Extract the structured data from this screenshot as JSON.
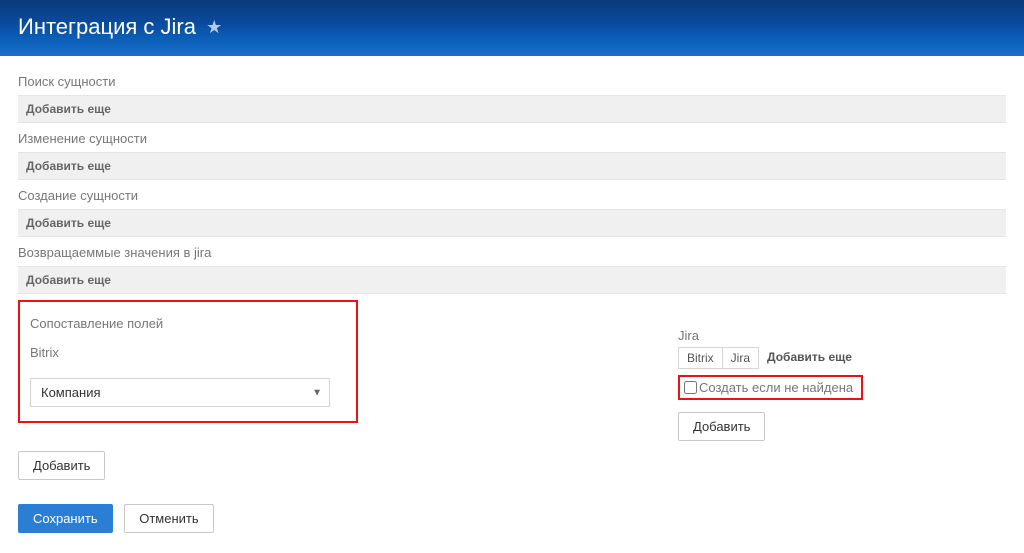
{
  "header": {
    "title": "Интеграция с Jira"
  },
  "sections": {
    "search_entity": "Поиск сущности",
    "change_entity": "Изменение сущности",
    "create_entity": "Создание сущности",
    "return_values": "Возвращаеммые значения в jira",
    "mapping_title": "Сопоставление полей"
  },
  "labels": {
    "add_more": "Добавить еще",
    "bitrix": "Bitrix",
    "jira": "Jira",
    "add": "Добавить",
    "save": "Сохранить",
    "cancel": "Отменить",
    "create_if_not_found": "Создать если не найдена"
  },
  "mapping": {
    "selected_bitrix_field": "Компания"
  },
  "subtabs": {
    "bitrix": "Bitrix",
    "jira": "Jira"
  }
}
